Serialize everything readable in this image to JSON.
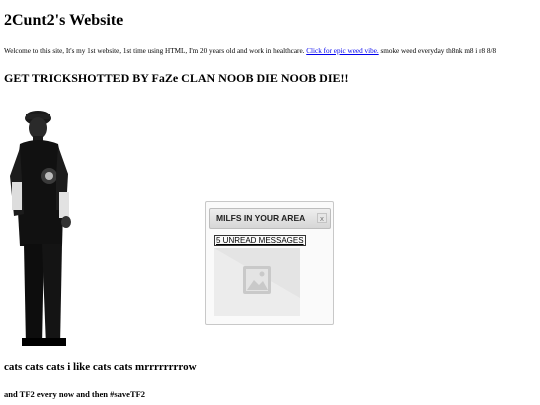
{
  "page": {
    "title": "2Cunt2's Website",
    "intro_text": "Welcome to this site, It's my 1st website, 1st time using HTML, I'm 20 years old and work in healthcare.",
    "intro_link": "Click for epic weed vibe.",
    "intro_after": "smoke weed everyday th8nk m8 i r8 8/8",
    "headline": "GET TRICKSHOTTED BY FaZe CLAN NOOB DIE NOOB DIE!!",
    "cats_line": "cats cats cats i like cats cats mrrrrrrrrow",
    "tf2_line": "and TF2 every now and then #saveTF2"
  },
  "ad": {
    "title": "MILFS IN YOUR AREA",
    "close_icon": "x",
    "link": "5 UNREAD MESSAGES",
    "image_icon": "image-placeholder-icon"
  },
  "colors": {
    "link": "#0000ee",
    "ad_header": "#d6d6d6",
    "ad_image_bg": "#e4e4e4"
  }
}
